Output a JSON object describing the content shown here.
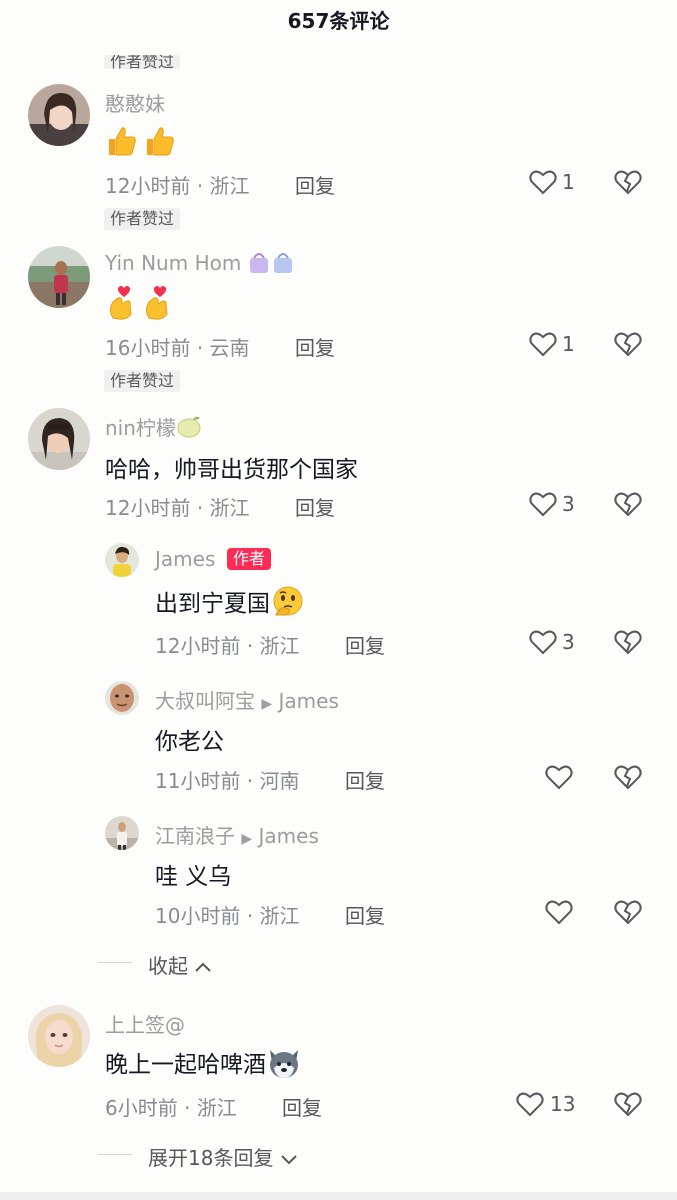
{
  "header": {
    "title": "657条评论"
  },
  "badges": {
    "author_liked": "作者赞过"
  },
  "comments": [
    {
      "name": "憨憨妹",
      "content": "",
      "time": "12小时前",
      "location": "浙江",
      "reply": "回复",
      "likes": "1"
    },
    {
      "name": "Yin Num Hom",
      "content": "",
      "time": "16小时前",
      "location": "云南",
      "reply": "回复",
      "likes": "1"
    },
    {
      "name": "nin柠檬",
      "content": "哈哈，帅哥出货那个国家",
      "time": "12小时前",
      "location": "浙江",
      "reply": "回复",
      "likes": "3"
    },
    {
      "name": "上上签@",
      "content": "晚上一起哈啤酒",
      "time": "6小时前",
      "location": "浙江",
      "reply": "回复",
      "likes": "13"
    }
  ],
  "replies": [
    {
      "name": "James",
      "tag": "作者",
      "content": "出到宁夏国",
      "time": "12小时前",
      "location": "浙江",
      "reply": "回复",
      "likes": "3"
    },
    {
      "name": "大叔叫阿宝",
      "to": "James",
      "content": "你老公",
      "time": "11小时前",
      "location": "河南",
      "reply": "回复",
      "likes": ""
    },
    {
      "name": "江南浪子",
      "to": "James",
      "content": "哇 义乌",
      "time": "10小时前",
      "location": "浙江",
      "reply": "回复",
      "likes": ""
    }
  ],
  "fold": {
    "collapse": "收起",
    "expand": "展开18条回复"
  },
  "meta_separator": "·",
  "icons": {
    "like": "heart-outline-icon",
    "dislike": "broken-heart-icon",
    "chevron_up": "chevron-up-icon",
    "chevron_down": "chevron-down-icon",
    "arrow": "triangle-right-icon"
  },
  "colors": {
    "author_tag": "#fe2c55",
    "text": "#161823",
    "secondary": "#8a8b91"
  }
}
